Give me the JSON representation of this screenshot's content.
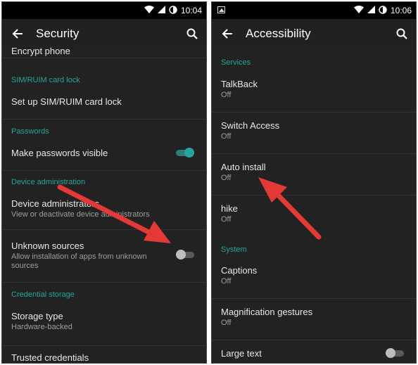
{
  "left": {
    "status": {
      "time": "10:04"
    },
    "toolbar": {
      "title": "Security"
    },
    "items": {
      "encrypt": {
        "title": "Encrypt phone"
      },
      "sim_category": "SIM/RUIM card lock",
      "sim_setup": {
        "title": "Set up SIM/RUIM card lock"
      },
      "passwords_category": "Passwords",
      "make_visible": {
        "title": "Make passwords visible",
        "toggle": "on"
      },
      "device_admin_category": "Device administration",
      "device_admins": {
        "title": "Device administrators",
        "summary": "View or deactivate device administrators"
      },
      "unknown_sources": {
        "title": "Unknown sources",
        "summary": "Allow installation of apps from unknown sources",
        "toggle": "off"
      },
      "credential_category": "Credential storage",
      "storage_type": {
        "title": "Storage type",
        "summary": "Hardware-backed"
      },
      "trusted": {
        "title": "Trusted credentials"
      }
    }
  },
  "right": {
    "status": {
      "time": "10:06"
    },
    "toolbar": {
      "title": "Accessibility"
    },
    "items": {
      "services_category": "Services",
      "talkback": {
        "title": "TalkBack",
        "summary": "Off"
      },
      "switch_access": {
        "title": "Switch Access",
        "summary": "Off"
      },
      "auto_install": {
        "title": "Auto install",
        "summary": "Off"
      },
      "hike": {
        "title": "hike",
        "summary": "Off"
      },
      "system_category": "System",
      "captions": {
        "title": "Captions",
        "summary": "Off"
      },
      "magnification": {
        "title": "Magnification gestures",
        "summary": "Off"
      },
      "large_text": {
        "title": "Large text",
        "toggle": "off"
      }
    }
  },
  "colors": {
    "accent": "#26a69a",
    "background": "#222222",
    "arrow": "#e53935"
  },
  "icons": [
    "wifi-icon",
    "signal-icon",
    "battery-icon",
    "back-arrow-icon",
    "search-icon",
    "notification-image-icon"
  ]
}
